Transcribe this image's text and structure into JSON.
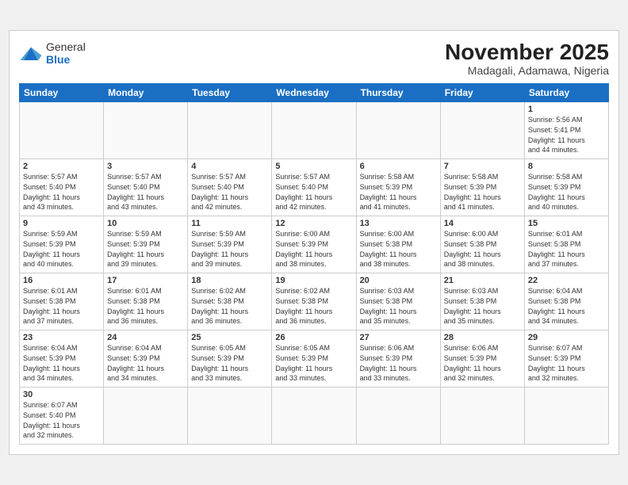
{
  "header": {
    "logo_general": "General",
    "logo_blue": "Blue",
    "month_year": "November 2025",
    "location": "Madagali, Adamawa, Nigeria"
  },
  "days_of_week": [
    "Sunday",
    "Monday",
    "Tuesday",
    "Wednesday",
    "Thursday",
    "Friday",
    "Saturday"
  ],
  "weeks": [
    [
      {
        "day": "",
        "info": ""
      },
      {
        "day": "",
        "info": ""
      },
      {
        "day": "",
        "info": ""
      },
      {
        "day": "",
        "info": ""
      },
      {
        "day": "",
        "info": ""
      },
      {
        "day": "",
        "info": ""
      },
      {
        "day": "1",
        "info": "Sunrise: 5:56 AM\nSunset: 5:41 PM\nDaylight: 11 hours\nand 44 minutes."
      }
    ],
    [
      {
        "day": "2",
        "info": "Sunrise: 5:57 AM\nSunset: 5:40 PM\nDaylight: 11 hours\nand 43 minutes."
      },
      {
        "day": "3",
        "info": "Sunrise: 5:57 AM\nSunset: 5:40 PM\nDaylight: 11 hours\nand 43 minutes."
      },
      {
        "day": "4",
        "info": "Sunrise: 5:57 AM\nSunset: 5:40 PM\nDaylight: 11 hours\nand 42 minutes."
      },
      {
        "day": "5",
        "info": "Sunrise: 5:57 AM\nSunset: 5:40 PM\nDaylight: 11 hours\nand 42 minutes."
      },
      {
        "day": "6",
        "info": "Sunrise: 5:58 AM\nSunset: 5:39 PM\nDaylight: 11 hours\nand 41 minutes."
      },
      {
        "day": "7",
        "info": "Sunrise: 5:58 AM\nSunset: 5:39 PM\nDaylight: 11 hours\nand 41 minutes."
      },
      {
        "day": "8",
        "info": "Sunrise: 5:58 AM\nSunset: 5:39 PM\nDaylight: 11 hours\nand 40 minutes."
      }
    ],
    [
      {
        "day": "9",
        "info": "Sunrise: 5:59 AM\nSunset: 5:39 PM\nDaylight: 11 hours\nand 40 minutes."
      },
      {
        "day": "10",
        "info": "Sunrise: 5:59 AM\nSunset: 5:39 PM\nDaylight: 11 hours\nand 39 minutes."
      },
      {
        "day": "11",
        "info": "Sunrise: 5:59 AM\nSunset: 5:39 PM\nDaylight: 11 hours\nand 39 minutes."
      },
      {
        "day": "12",
        "info": "Sunrise: 6:00 AM\nSunset: 5:39 PM\nDaylight: 11 hours\nand 38 minutes."
      },
      {
        "day": "13",
        "info": "Sunrise: 6:00 AM\nSunset: 5:38 PM\nDaylight: 11 hours\nand 38 minutes."
      },
      {
        "day": "14",
        "info": "Sunrise: 6:00 AM\nSunset: 5:38 PM\nDaylight: 11 hours\nand 38 minutes."
      },
      {
        "day": "15",
        "info": "Sunrise: 6:01 AM\nSunset: 5:38 PM\nDaylight: 11 hours\nand 37 minutes."
      }
    ],
    [
      {
        "day": "16",
        "info": "Sunrise: 6:01 AM\nSunset: 5:38 PM\nDaylight: 11 hours\nand 37 minutes."
      },
      {
        "day": "17",
        "info": "Sunrise: 6:01 AM\nSunset: 5:38 PM\nDaylight: 11 hours\nand 36 minutes."
      },
      {
        "day": "18",
        "info": "Sunrise: 6:02 AM\nSunset: 5:38 PM\nDaylight: 11 hours\nand 36 minutes."
      },
      {
        "day": "19",
        "info": "Sunrise: 6:02 AM\nSunset: 5:38 PM\nDaylight: 11 hours\nand 36 minutes."
      },
      {
        "day": "20",
        "info": "Sunrise: 6:03 AM\nSunset: 5:38 PM\nDaylight: 11 hours\nand 35 minutes."
      },
      {
        "day": "21",
        "info": "Sunrise: 6:03 AM\nSunset: 5:38 PM\nDaylight: 11 hours\nand 35 minutes."
      },
      {
        "day": "22",
        "info": "Sunrise: 6:04 AM\nSunset: 5:38 PM\nDaylight: 11 hours\nand 34 minutes."
      }
    ],
    [
      {
        "day": "23",
        "info": "Sunrise: 6:04 AM\nSunset: 5:39 PM\nDaylight: 11 hours\nand 34 minutes."
      },
      {
        "day": "24",
        "info": "Sunrise: 6:04 AM\nSunset: 5:39 PM\nDaylight: 11 hours\nand 34 minutes."
      },
      {
        "day": "25",
        "info": "Sunrise: 6:05 AM\nSunset: 5:39 PM\nDaylight: 11 hours\nand 33 minutes."
      },
      {
        "day": "26",
        "info": "Sunrise: 6:05 AM\nSunset: 5:39 PM\nDaylight: 11 hours\nand 33 minutes."
      },
      {
        "day": "27",
        "info": "Sunrise: 6:06 AM\nSunset: 5:39 PM\nDaylight: 11 hours\nand 33 minutes."
      },
      {
        "day": "28",
        "info": "Sunrise: 6:06 AM\nSunset: 5:39 PM\nDaylight: 11 hours\nand 32 minutes."
      },
      {
        "day": "29",
        "info": "Sunrise: 6:07 AM\nSunset: 5:39 PM\nDaylight: 11 hours\nand 32 minutes."
      }
    ],
    [
      {
        "day": "30",
        "info": "Sunrise: 6:07 AM\nSunset: 5:40 PM\nDaylight: 11 hours\nand 32 minutes."
      },
      {
        "day": "",
        "info": ""
      },
      {
        "day": "",
        "info": ""
      },
      {
        "day": "",
        "info": ""
      },
      {
        "day": "",
        "info": ""
      },
      {
        "day": "",
        "info": ""
      },
      {
        "day": "",
        "info": ""
      }
    ]
  ]
}
